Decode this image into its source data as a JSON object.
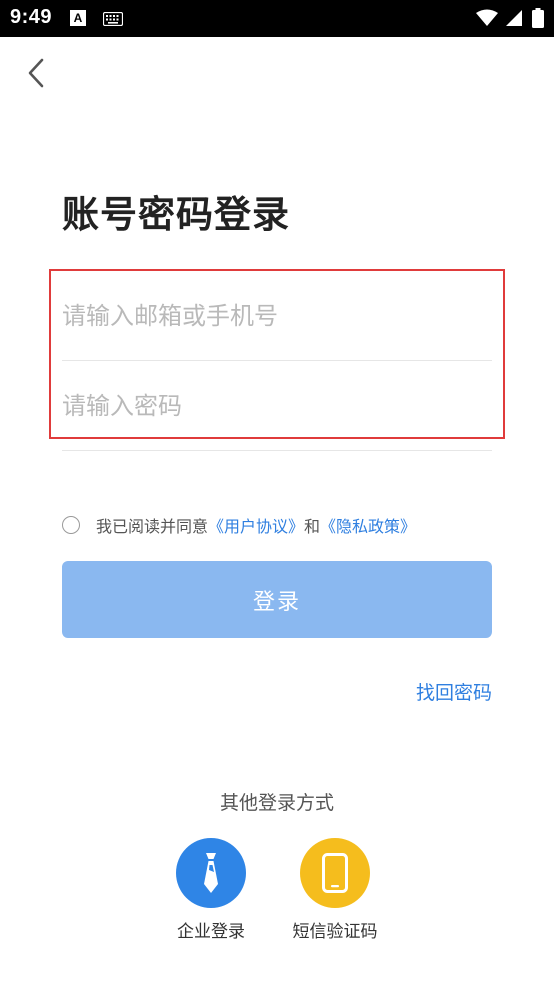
{
  "status_bar": {
    "time": "9:49",
    "a_icon_letter": "A"
  },
  "page": {
    "title": "账号密码登录"
  },
  "form": {
    "email_placeholder": "请输入邮箱或手机号",
    "email_value": "",
    "password_placeholder": "请输入密码",
    "password_value": ""
  },
  "agreement": {
    "prefix": "我已阅读并同意",
    "user_agreement": "《用户协议》",
    "connector": "和",
    "privacy_policy": "《隐私政策》",
    "checked": false
  },
  "actions": {
    "login_label": "登录",
    "forgot_password": "找回密码"
  },
  "other_login": {
    "title": "其他登录方式",
    "methods": [
      {
        "label": "企业登录",
        "icon": "tie-icon",
        "color": "#2f85e6"
      },
      {
        "label": "短信验证码",
        "icon": "phone-icon",
        "color": "#f5bd1d"
      }
    ]
  },
  "colors": {
    "accent": "#2f7fe0",
    "login_button_disabled": "#8ab8f0",
    "highlight": "#e03b3b"
  }
}
